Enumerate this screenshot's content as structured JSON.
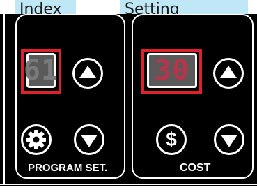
{
  "tabs": {
    "index": "Index",
    "setting_number": "Setting Number"
  },
  "program": {
    "index_value": "61",
    "label": "PROGRAM SET."
  },
  "cost": {
    "value": "30",
    "label": "COST"
  },
  "icons": {
    "up": "up-arrow-icon",
    "down": "down-arrow-icon",
    "gear": "gear-icon",
    "dollar": "dollar-icon"
  },
  "colors": {
    "highlight": "#e0202a",
    "tab_background": "#bfe7f6",
    "panel": "#000000"
  }
}
